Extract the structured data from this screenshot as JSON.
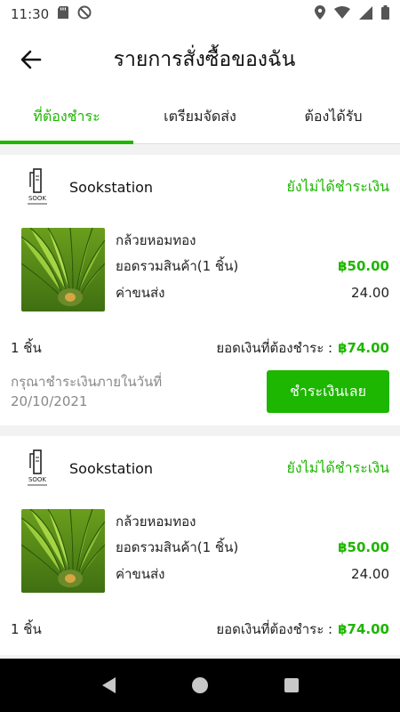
{
  "status_bar": {
    "time": "11:30"
  },
  "header": {
    "title": "รายการสั่งซื้อของฉัน"
  },
  "tabs": [
    {
      "label": "ที่ต้องชำระ",
      "active": true
    },
    {
      "label": "เตรียมจัดส่ง",
      "active": false
    },
    {
      "label": "ต้องได้รับ",
      "active": false
    }
  ],
  "orders": [
    {
      "shop_name": "Sookstation",
      "status": "ยังไม่ได้ชำระเงิน",
      "product_name": "กล้วยหอมทอง",
      "subtotal_label": "ยอดรวมสินค้า(1 ชิ้น)",
      "subtotal_value": "฿50.00",
      "shipping_label": "ค่าขนส่ง",
      "shipping_value": "24.00",
      "qty": "1 ชิ้น",
      "total_label": "ยอดเงินที่ต้องชำระ :",
      "total_value": "฿74.00",
      "due_label": "กรุณาชำระเงินภายในวันที่",
      "due_date": "20/10/2021",
      "pay_label": "ชำระเงินเลย"
    },
    {
      "shop_name": "Sookstation",
      "status": "ยังไม่ได้ชำระเงิน",
      "product_name": "กล้วยหอมทอง",
      "subtotal_label": "ยอดรวมสินค้า(1 ชิ้น)",
      "subtotal_value": "฿50.00",
      "shipping_label": "ค่าขนส่ง",
      "shipping_value": "24.00",
      "qty": "1 ชิ้น",
      "total_label": "ยอดเงินที่ต้องชำระ :",
      "total_value": "฿74.00"
    }
  ],
  "logo_text": "SOOK",
  "icons": {
    "back": "arrow-left-icon",
    "nav_back": "triangle-back-icon",
    "nav_home": "circle-home-icon",
    "nav_recent": "square-recent-icon"
  },
  "colors": {
    "accent": "#1db600"
  }
}
